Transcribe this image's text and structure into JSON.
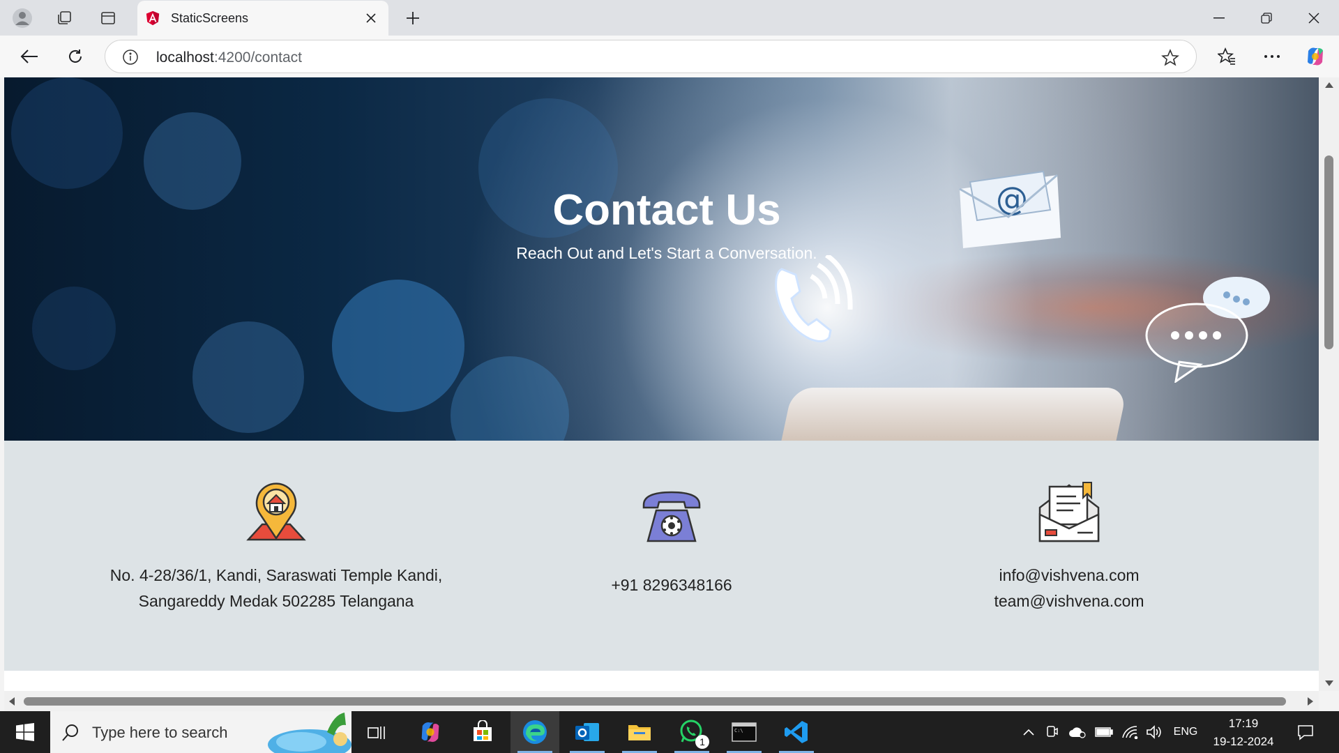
{
  "browser": {
    "tab_title": "StaticScreens",
    "url_host": "localhost",
    "url_path": ":4200/contact"
  },
  "hero": {
    "title": "Contact Us",
    "subtitle": "Reach Out and Let's Start a Conversation."
  },
  "contact": {
    "address_line1": "No. 4-28/36/1, Kandi, Saraswati Temple Kandi,",
    "address_line2": "Sangareddy Medak 502285 Telangana",
    "phone": "+91 8296348166",
    "email1": "info@vishvena.com",
    "email2": "team@vishvena.com"
  },
  "taskbar": {
    "search_placeholder": "Type here to search",
    "whatsapp_badge": "1",
    "language": "ENG",
    "time": "17:19",
    "date": "19-12-2024"
  }
}
